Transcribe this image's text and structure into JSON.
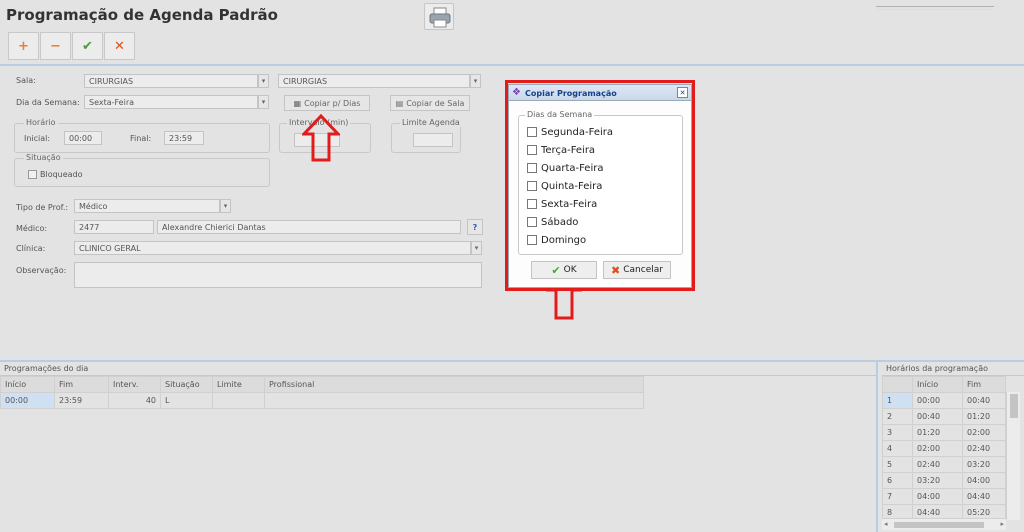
{
  "page": {
    "title": "Programação de Agenda Padrão"
  },
  "toolbar": {
    "add": "+",
    "remove": "−",
    "confirm": "✔",
    "cancel": "✕"
  },
  "form": {
    "sala_label": "Sala:",
    "sala_value": "CIRURGIAS",
    "sala_value2": "CIRURGIAS",
    "dia_label": "Dia da Semana:",
    "dia_value": "Sexta-Feira",
    "copiar_dias_button": "Copiar p/ Dias",
    "copiar_sala_button": "Copiar de Sala",
    "horario_legend": "Horário",
    "inicial_label": "Inicial:",
    "inicial_value": "00:00",
    "final_label": "Final:",
    "final_value": "23:59",
    "intervalo_legend": "Intervalo (min)",
    "limite_legend": "Limite Agenda",
    "situacao_legend": "Situação",
    "bloqueado_label": "Bloqueado",
    "tipo_prof_label": "Tipo de Prof.:",
    "tipo_prof_value": "Médico",
    "medico_label": "Médico:",
    "medico_code": "2477",
    "medico_name": "Alexandre Chierici Dantas",
    "help": "?",
    "clinica_label": "Clínica:",
    "clinica_value": "CLINICO GERAL",
    "observacao_label": "Observação:"
  },
  "dialog": {
    "title": "Copiar Programação",
    "close": "✕",
    "legend": "Dias da Semana",
    "days": [
      "Segunda-Feira",
      "Terça-Feira",
      "Quarta-Feira",
      "Quinta-Feira",
      "Sexta-Feira",
      "Sábado",
      "Domingo"
    ],
    "ok_button": "OK",
    "cancel_button": "Cancelar"
  },
  "programacoes": {
    "title": "Programações do dia",
    "columns": [
      "Início",
      "Fim",
      "Interv.",
      "Situação",
      "Limite",
      "Profissional"
    ],
    "rows": [
      [
        "00:00",
        "23:59",
        "40",
        "L",
        "",
        ""
      ]
    ]
  },
  "horarios": {
    "title": "Horários da programação",
    "columns": [
      "",
      "Início",
      "Fim"
    ],
    "rows": [
      [
        "1",
        "00:00",
        "00:40"
      ],
      [
        "2",
        "00:40",
        "01:20"
      ],
      [
        "3",
        "01:20",
        "02:00"
      ],
      [
        "4",
        "02:00",
        "02:40"
      ],
      [
        "5",
        "02:40",
        "03:20"
      ],
      [
        "6",
        "03:20",
        "04:00"
      ],
      [
        "7",
        "04:00",
        "04:40"
      ],
      [
        "8",
        "04:40",
        "05:20"
      ]
    ]
  },
  "colors": {
    "highlight": "#e21b1b",
    "ok_check": "#3cae2c",
    "cancel_x": "#d9501e"
  }
}
